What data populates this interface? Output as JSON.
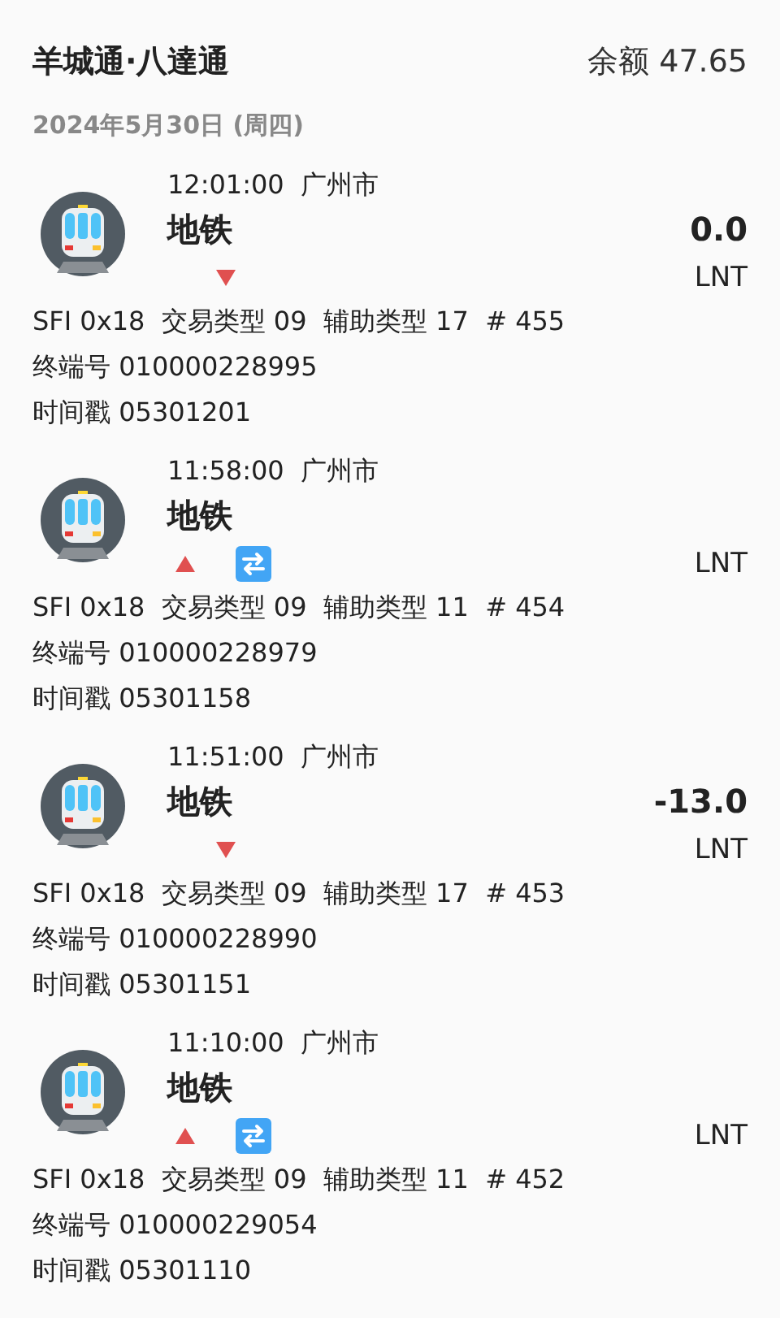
{
  "header": {
    "title": "羊城通·八達通",
    "balance": "余额 47.65"
  },
  "date": "2024年5月30日 (周四)",
  "records": [
    {
      "time": "12:01:00",
      "city": "广州市",
      "title": "地铁",
      "up": false,
      "transfer": false,
      "amount": "0.0",
      "currency": "LNT",
      "details": [
        "SFI 0x18  交易类型 09  辅助类型 17  # 455",
        "终端号 010000228995",
        "时间戳 05301201"
      ]
    },
    {
      "time": "11:58:00",
      "city": "广州市",
      "title": "地铁",
      "up": true,
      "transfer": true,
      "currency": "LNT",
      "details": [
        "SFI 0x18  交易类型 09  辅助类型 11  # 454",
        "终端号 010000228979",
        "时间戳 05301158"
      ]
    },
    {
      "time": "11:51:00",
      "city": "广州市",
      "title": "地铁",
      "up": false,
      "transfer": false,
      "amount": "-13.0",
      "currency": "LNT",
      "details": [
        "SFI 0x18  交易类型 09  辅助类型 17  # 453",
        "终端号 010000228990",
        "时间戳 05301151"
      ]
    },
    {
      "time": "11:10:00",
      "city": "广州市",
      "title": "地铁",
      "up": true,
      "transfer": true,
      "currency": "LNT",
      "details": [
        "SFI 0x18  交易类型 09  辅助类型 11  # 452",
        "终端号 010000229054",
        "时间戳 05301110"
      ]
    }
  ]
}
